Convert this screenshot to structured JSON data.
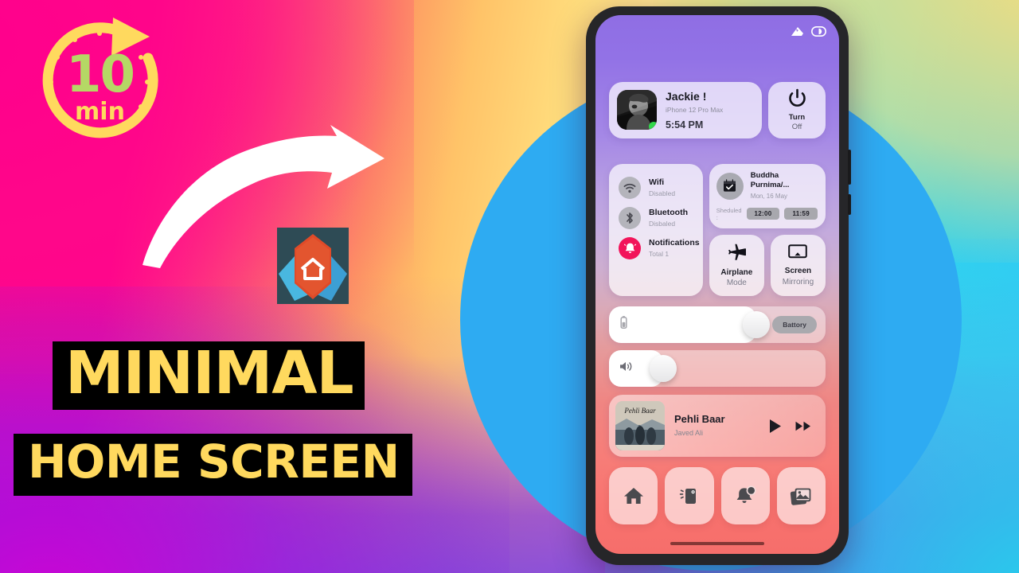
{
  "thumbnail": {
    "badge": {
      "number": "10",
      "unit": "min"
    },
    "titles": {
      "line1": "MINIMAL",
      "line2": "HOME SCREEN"
    },
    "app_icon": "nova-launcher-icon",
    "arrow": "curved-arrow-icon",
    "colors": {
      "badge_number": "#b5d865",
      "badge_unit": "#ffd95e",
      "title_text": "#ffd95e",
      "title_bg": "#000000",
      "circle": "#2eabf2",
      "phone_frame": "#262629"
    }
  },
  "phone": {
    "statusbar": {
      "signal_icon": "signal-icon",
      "battery_icon": "battery-icon"
    },
    "contact": {
      "name": "Jackie !",
      "device": "iPhone 12 Pro Max",
      "time": "5:54 PM",
      "avatar": "portrait-avatar",
      "status": "online"
    },
    "power": {
      "icon": "power-icon",
      "line1": "Turn",
      "line2": "Off"
    },
    "toggles": [
      {
        "icon": "wifi-icon",
        "title": "Wifi",
        "subtitle": "Disabled",
        "active": false
      },
      {
        "icon": "bluetooth-icon",
        "title": "Bluetooth",
        "subtitle": "Disbaled",
        "active": false
      },
      {
        "icon": "bell-icon",
        "title": "Notifications",
        "subtitle": "Total 1",
        "active": true
      }
    ],
    "calendar": {
      "icon": "calendar-check-icon",
      "title": "Buddha Purnima/...",
      "date": "Mon, 16 May",
      "scheduled_label": "Sheduled :",
      "time_start": "12:00",
      "time_end": "11:59"
    },
    "tiles": [
      {
        "icon": "airplane-icon",
        "line1": "Airplane",
        "line2": "Mode"
      },
      {
        "icon": "screencast-icon",
        "line1": "Screen",
        "line2": "Mirroring"
      }
    ],
    "battery_slider": {
      "icon": "battery-vertical-icon",
      "pill_label": "Battory",
      "value": 68
    },
    "volume_slider": {
      "icon": "speaker-icon",
      "value": 25
    },
    "music": {
      "album_art": "pehli-baar-album-art",
      "album_art_text": "Pehli Baar",
      "title": "Pehli Baar",
      "artist": "Javed Ali",
      "play_icon": "play-icon",
      "next_icon": "fast-forward-icon"
    },
    "dock": [
      {
        "icon": "home-icon"
      },
      {
        "icon": "vibrate-phone-icon"
      },
      {
        "icon": "bell-badge-icon"
      },
      {
        "icon": "gallery-icon"
      }
    ]
  }
}
